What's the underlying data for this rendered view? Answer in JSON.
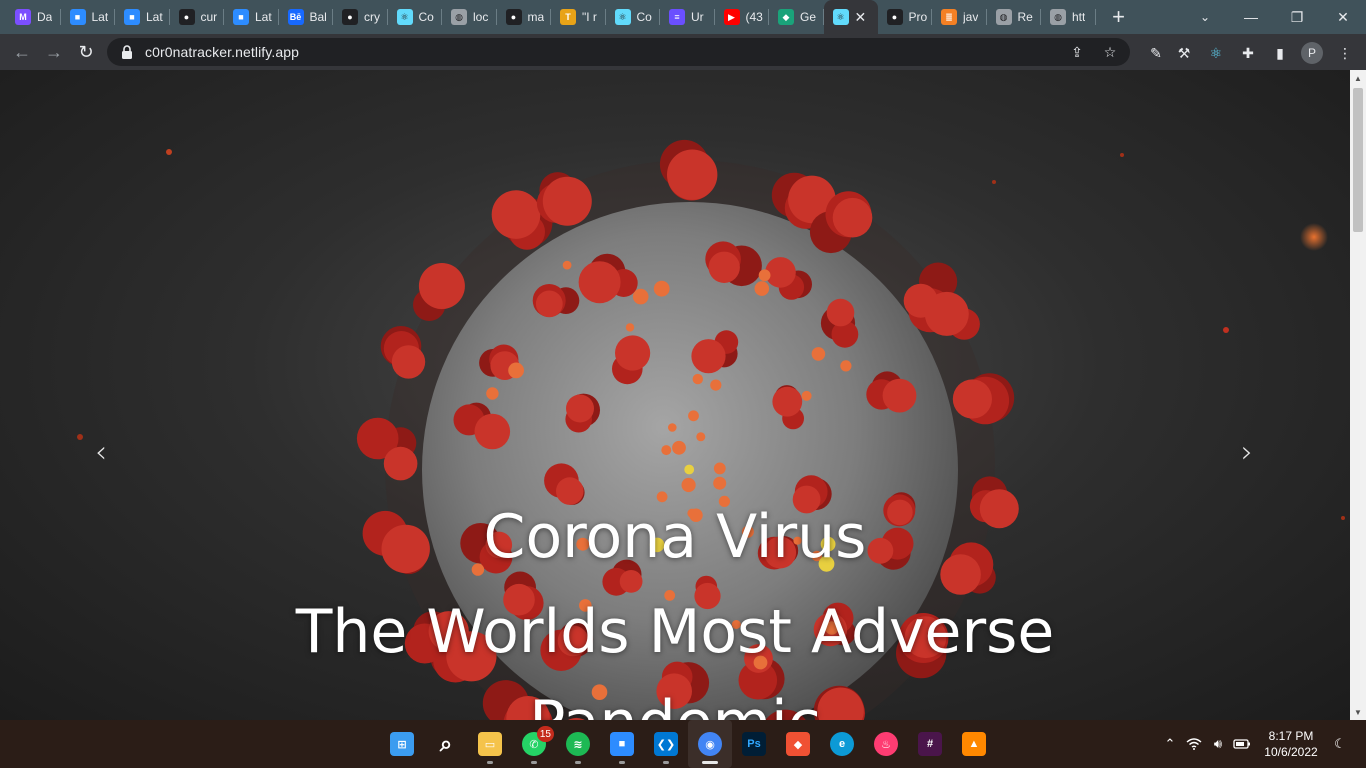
{
  "browser": {
    "tabs": [
      {
        "title": "Da",
        "icon": "dash-icon",
        "color": "#7b4fff"
      },
      {
        "title": "Lat",
        "icon": "zoom-icon",
        "color": "#2d8cff"
      },
      {
        "title": "Lat",
        "icon": "zoom-icon",
        "color": "#2d8cff"
      },
      {
        "title": "cur",
        "icon": "github-icon",
        "color": "#202124"
      },
      {
        "title": "Lat",
        "icon": "zoom-icon",
        "color": "#2d8cff"
      },
      {
        "title": "Bal",
        "icon": "behance-icon",
        "color": "#1769ff"
      },
      {
        "title": "cry",
        "icon": "github-icon",
        "color": "#202124"
      },
      {
        "title": "Co",
        "icon": "react-icon",
        "color": "#61dafb"
      },
      {
        "title": "loc",
        "icon": "globe-icon",
        "color": "#9aa0a6"
      },
      {
        "title": "ma",
        "icon": "github-icon",
        "color": "#202124"
      },
      {
        "title": "\"I r",
        "icon": "text-icon",
        "color": "#e8a317"
      },
      {
        "title": "Co",
        "icon": "react-icon",
        "color": "#61dafb"
      },
      {
        "title": "Ur",
        "icon": "list-icon",
        "color": "#6a4fff"
      },
      {
        "title": "(43",
        "icon": "youtube-icon",
        "color": "#ff0000"
      },
      {
        "title": "Ge",
        "icon": "diamond-icon",
        "color": "#1aa37a"
      },
      {
        "title": "",
        "icon": "react-icon",
        "color": "#61dafb",
        "active": true
      },
      {
        "title": "Pro",
        "icon": "github-icon",
        "color": "#202124"
      },
      {
        "title": "jav",
        "icon": "stackoverflow-icon",
        "color": "#f48024"
      },
      {
        "title": "Re",
        "icon": "globe-icon",
        "color": "#9aa0a6"
      },
      {
        "title": "htt",
        "icon": "globe-icon",
        "color": "#9aa0a6"
      }
    ],
    "new_tab_label": "+",
    "tab_close_label": "✕",
    "url": "c0r0natracker.netlify.app",
    "profile_initial": "P"
  },
  "page": {
    "caption_line1": "Corona Virus",
    "caption_line2": "The Worlds Most Adverse",
    "caption_line3": "Pandemic",
    "prev_arrow": "‹",
    "next_arrow": "›"
  },
  "taskbar": {
    "apps": [
      {
        "name": "start-icon",
        "active": false
      },
      {
        "name": "search-icon",
        "active": false
      },
      {
        "name": "file-explorer-icon",
        "active": false
      },
      {
        "name": "whatsapp-icon",
        "active": false,
        "badge": "15"
      },
      {
        "name": "spotify-icon",
        "active": false
      },
      {
        "name": "zoom-icon",
        "active": false
      },
      {
        "name": "vscode-icon",
        "active": false
      },
      {
        "name": "chrome-icon",
        "active": true
      },
      {
        "name": "photoshop-icon",
        "active": false,
        "label": "Ps"
      },
      {
        "name": "git-icon",
        "active": false
      },
      {
        "name": "edge-icon",
        "active": false
      },
      {
        "name": "tinder-icon",
        "active": false
      },
      {
        "name": "slack-icon",
        "active": false
      },
      {
        "name": "vlc-icon",
        "active": false
      }
    ],
    "time": "8:17 PM",
    "date": "10/6/2022"
  },
  "colors": {
    "tabstrip": "#40525a",
    "toolbar": "#35363a",
    "virus_spike": "#b2231d",
    "virus_body": "#8a8a8a",
    "taskbar": "#2b1d17"
  }
}
